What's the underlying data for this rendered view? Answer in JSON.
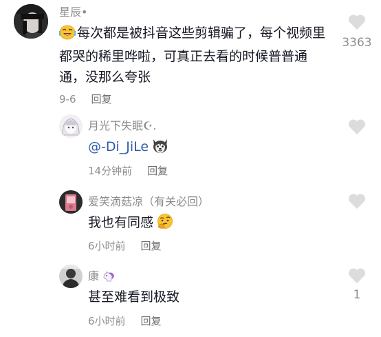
{
  "main_comment": {
    "author": "星辰•",
    "text": "每次都是被抖音这些剪辑骗了，每个视频里都哭的稀里哗啦，可真正去看的时候普普通通，没那么夸张",
    "date": "9-6",
    "reply_label": "回复",
    "like_count": "3363",
    "leading_emoji": "laughing-crying-emoji"
  },
  "replies": [
    {
      "author": "月光下失眠☪︎.",
      "mention": "@-Di_JiLe",
      "text": "",
      "time": "14分钟前",
      "reply_label": "回复",
      "like_count": "",
      "trailing_emoji": "husky-dog-emoji"
    },
    {
      "author": "爱笑滴菇凉（有关必回）",
      "text": "我也有同感",
      "time": "6小时前",
      "reply_label": "回复",
      "like_count": "",
      "trailing_emoji": "thinking-face-emoji"
    },
    {
      "author": "康",
      "text": "甚至难看到极致",
      "time": "6小时前",
      "reply_label": "回复",
      "like_count": "1",
      "name_emoji": "unicorn-emoji"
    }
  ],
  "colors": {
    "heart": "#dcdcdc",
    "mention": "#2f5ba8",
    "meta": "#8e8e8e"
  }
}
